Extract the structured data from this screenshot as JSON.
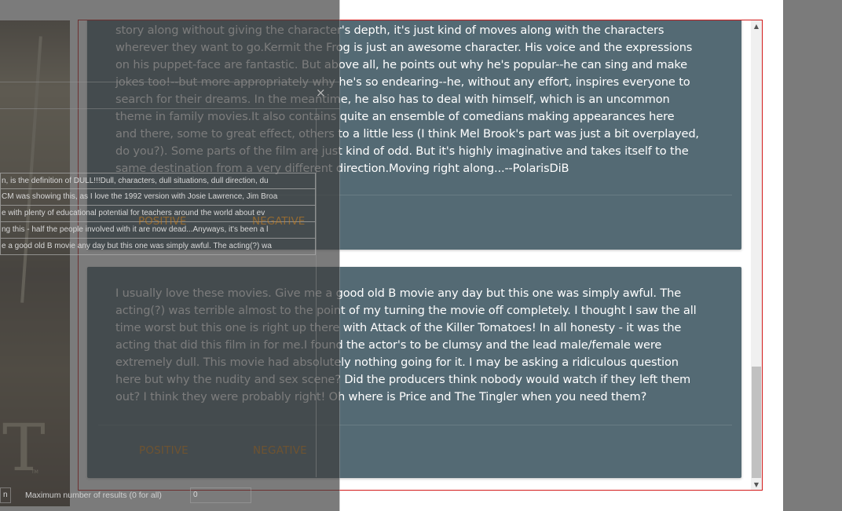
{
  "reviews": [
    {
      "text": "story along without giving the character's depth, it's just kind of moves along with the characters\nwherever they want to go.Kermit the Frog is just an awesome character. His voice and the expressions\non his puppet-face are fantastic. But above all, he points out why he's popular--he can sing and make\njokes too!--but more appropriately why he's so endearing--he, without any effort, inspires everyone to\nsearch for their dreams. In the meantime, he also has to deal with himself, which is an uncommon\ntheme in family movies.It also contains quite an ensemble of comedians making appearances here\nand there, some to great effect, others to a little less (I think Mel Brook's part was just a bit overplayed,\ndo you?). Some parts of the film are just kind of odd. But it's highly imaginative and takes itself to the\nsame destination from a very different direction.Moving right along...--PolarisDiB",
      "positive_label": "POSITIVE",
      "negative_label": "NEGATIVE"
    },
    {
      "text": "I usually love these movies. Give me a good old B movie any day but this one was simply awful. The\nacting(?) was terrible almost to the point of my turning the movie off completely. I thought I saw the all\ntime worst but this one is right up there with Attack of the Killer Tomatoes! In all honesty - it was the\nacting that did this film in for me.I found the actor's to be clumsy and the lead male/female were\nextremely dull. This movie had absolutely nothing going for it. I may be asking a ridiculous question\nhere but why the nudity and sex scene? Did the producers think nobody would watch if they left them\nout? I think they were probably right! Oh where is Price and The Tingler when you need them?",
      "positive_label": "POSITIVE",
      "negative_label": "NEGATIVE"
    }
  ],
  "overlay": {
    "close_glyph": "×",
    "list_rows": [
      "n, is the definition of DULL!!!Dull, characters, dull situations, dull direction, du",
      "CM was showing this, as I love the 1992 version with Josie Lawrence, Jim Broa",
      "e with plenty of educational potential for teachers around the world about ev",
      "ng this - half the people involved with it are now dead...Anyways, it's been a l",
      "e a good old B movie any day but this one was simply awful. The acting(?) wa"
    ],
    "left_field_value": "n",
    "max_results_label": "Maximum number of results (0 for all)",
    "max_results_value": "0",
    "poster_letters": "T",
    "poster_tm": "TM"
  },
  "icons": {
    "close": "close-icon",
    "scroll_up": "scroll-up-icon",
    "scroll_down": "scroll-down-icon"
  },
  "colors": {
    "card_bg": "#546a74",
    "button_text": "#d4831a",
    "panel_border": "#d31a1a"
  }
}
